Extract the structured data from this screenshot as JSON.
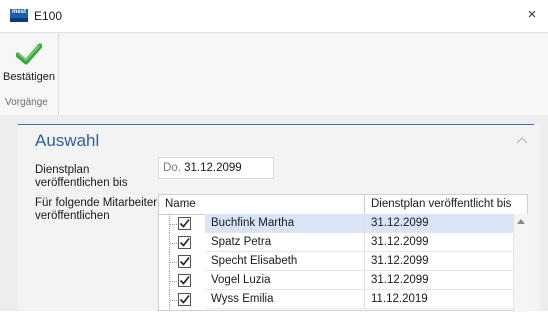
{
  "window": {
    "title": "E100",
    "logo_text": "mest",
    "close_symbol": "×"
  },
  "ribbon": {
    "confirm_label": "Bestätigen",
    "group_label": "Vorgänge"
  },
  "section": {
    "title": "Auswahl"
  },
  "form": {
    "publish_label": "Dienstplan veröffentlichen bis",
    "publish_day": "Do.",
    "publish_date": "31.12.2099",
    "employees_label": "Für folgende Mitarbeiter veröffentlichen"
  },
  "table": {
    "columns": [
      "Name",
      "Dienstplan veröffentlicht bis"
    ],
    "rows": [
      {
        "name": "Buchfink Martha",
        "date": "31.12.2099",
        "checked": true,
        "selected": true
      },
      {
        "name": "Spatz Petra",
        "date": "31.12.2099",
        "checked": true,
        "selected": false
      },
      {
        "name": "Specht Elisabeth",
        "date": "31.12.2099",
        "checked": true,
        "selected": false
      },
      {
        "name": "Vogel Luzia",
        "date": "31.12.2099",
        "checked": true,
        "selected": false
      },
      {
        "name": "Wyss Emilia",
        "date": "11.12.2019",
        "checked": true,
        "selected": false
      }
    ]
  },
  "colors": {
    "accent": "#2f5f9f",
    "check_green": "#3aa83a",
    "selection": "#d9e5f7"
  },
  "icons": {
    "confirm": "green-check-icon",
    "collapse": "chevron-up-icon",
    "scroll": "scroll-up-icon"
  }
}
